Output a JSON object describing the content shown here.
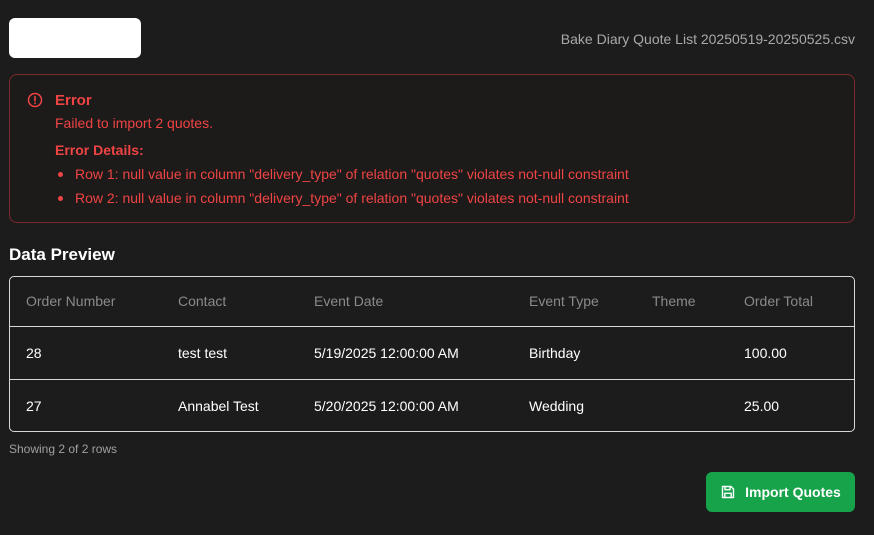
{
  "header": {
    "file_name": "Bake Diary Quote List 20250519-20250525.csv"
  },
  "error": {
    "icon": "alert-circle-icon",
    "title": "Error",
    "message": "Failed to import 2 quotes.",
    "details_label": "Error Details:",
    "details": [
      "Row 1: null value in column \"delivery_type\" of relation \"quotes\" violates not-null constraint",
      "Row 2: null value in column \"delivery_type\" of relation \"quotes\" violates not-null constraint"
    ],
    "color": "#ef4444"
  },
  "preview": {
    "title": "Data Preview",
    "columns": [
      "Order Number",
      "Contact",
      "Event Date",
      "Event Type",
      "Theme",
      "Order Total"
    ],
    "rows": [
      [
        "28",
        "test test",
        "5/19/2025 12:00:00 AM",
        "Birthday",
        "",
        "100.00"
      ],
      [
        "27",
        "Annabel Test",
        "5/20/2025 12:00:00 AM",
        "Wedding",
        "",
        "25.00"
      ]
    ],
    "row_count": "Showing 2 of 2 rows"
  },
  "actions": {
    "import_label": "Import Quotes",
    "import_icon": "save-icon",
    "accent": "#16a34a"
  }
}
